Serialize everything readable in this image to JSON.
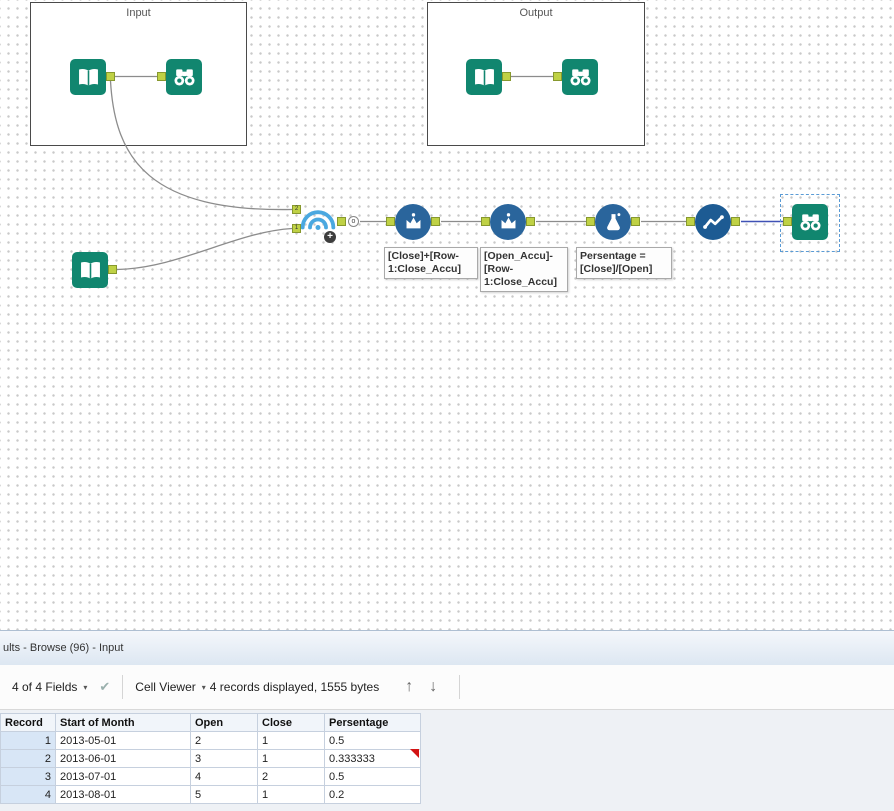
{
  "canvas": {
    "containers": [
      {
        "label": "Input"
      },
      {
        "label": "Output"
      }
    ],
    "union_tool": {
      "plus_badge": "+",
      "output_label": "o",
      "input_top_label": "2",
      "input_bottom_label": "1"
    },
    "annotations": [
      {
        "text": "[Close]+[Row-1:Close_Accu]"
      },
      {
        "text": "[Open_Accu]-[Row-1:Close_Accu]"
      },
      {
        "text": "Persentage = [Close]/[Open]"
      }
    ]
  },
  "results_panel": {
    "title": "ults - Browse (96) - Input",
    "toolbar": {
      "fields_label": "4 of 4 Fields",
      "cell_viewer_label": "Cell Viewer",
      "records_info": "4 records displayed, 1555 bytes"
    },
    "table": {
      "columns": [
        "Record",
        "Start of Month",
        "Open",
        "Close",
        "Persentage"
      ],
      "rows": [
        [
          "1",
          "2013-05-01",
          "2",
          "1",
          "0.5"
        ],
        [
          "2",
          "2013-06-01",
          "3",
          "1",
          "0.333333"
        ],
        [
          "3",
          "2013-07-01",
          "4",
          "2",
          "0.5"
        ],
        [
          "4",
          "2013-08-01",
          "5",
          "1",
          "0.2"
        ]
      ]
    }
  },
  "icons": {
    "caret": "▾",
    "check": "✔",
    "up_arrow": "↑",
    "down_arrow": "↓"
  },
  "colors": {
    "tool_teal": "#11866f",
    "tool_blue": "#2a659c",
    "tool_blue_dark": "#1d5b93",
    "union_blue": "#4aa8e0",
    "anchor_green": "#bfd145",
    "selected_wire": "#3f51b5",
    "flag_red": "#d31414"
  }
}
